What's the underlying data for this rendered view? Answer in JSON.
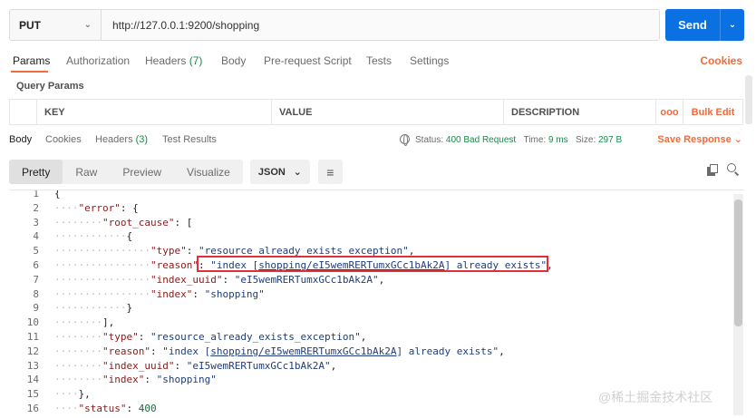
{
  "request": {
    "method": "PUT",
    "url": "http://127.0.0.1:9200/shopping",
    "send_label": "Send"
  },
  "request_tabs": [
    {
      "label": "Params",
      "active": true
    },
    {
      "label": "Authorization"
    },
    {
      "label": "Headers",
      "count": "(7)"
    },
    {
      "label": "Body"
    },
    {
      "label": "Pre-request Script"
    },
    {
      "label": "Tests"
    },
    {
      "label": "Settings"
    }
  ],
  "cookies_label": "Cookies",
  "query_params": {
    "title": "Query Params",
    "columns": [
      "KEY",
      "VALUE",
      "DESCRIPTION"
    ],
    "more_label": "ooo",
    "bulk_edit_label": "Bulk Edit"
  },
  "response_tabs": [
    {
      "label": "Body",
      "active": true
    },
    {
      "label": "Cookies"
    },
    {
      "label": "Headers",
      "count": "(3)"
    },
    {
      "label": "Test Results"
    }
  ],
  "response_status": {
    "status_label": "Status:",
    "status_value": "400 Bad Request",
    "time_label": "Time:",
    "time_value": "9 ms",
    "size_label": "Size:",
    "size_value": "297 B",
    "save_label": "Save Response"
  },
  "viewer": {
    "modes": [
      "Pretty",
      "Raw",
      "Preview",
      "Visualize"
    ],
    "active_mode": "Pretty",
    "format": "JSON"
  },
  "code_lines": [
    {
      "n": "1",
      "dots": "",
      "text": "{"
    },
    {
      "n": "2",
      "dots": "····",
      "text": "\"error\": {"
    },
    {
      "n": "3",
      "dots": "········",
      "text": "\"root_cause\": ["
    },
    {
      "n": "4",
      "dots": "············",
      "text": "{"
    },
    {
      "n": "5",
      "dots": "················",
      "text": "\"type\": \"resource_already_exists_exception\","
    },
    {
      "n": "6",
      "dots": "················",
      "text": "\"reason\": \"index [shopping/eI5wemRERTumxGCc1bAk2A] already exists\","
    },
    {
      "n": "7",
      "dots": "················",
      "text": "\"index_uuid\": \"eI5wemRERTumxGCc1bAk2A\","
    },
    {
      "n": "8",
      "dots": "················",
      "text": "\"index\": \"shopping\""
    },
    {
      "n": "9",
      "dots": "············",
      "text": "}"
    },
    {
      "n": "10",
      "dots": "········",
      "text": "],"
    },
    {
      "n": "11",
      "dots": "········",
      "text": "\"type\": \"resource_already_exists_exception\","
    },
    {
      "n": "12",
      "dots": "········",
      "text": "\"reason\": \"index [shopping/eI5wemRERTumxGCc1bAk2A] already exists\","
    },
    {
      "n": "13",
      "dots": "········",
      "text": "\"index_uuid\": \"eI5wemRERTumxGCc1bAk2A\","
    },
    {
      "n": "14",
      "dots": "········",
      "text": "\"index\": \"shopping\""
    },
    {
      "n": "15",
      "dots": "····",
      "text": "},"
    },
    {
      "n": "16",
      "dots": "····",
      "text": "\"status\": 400"
    }
  ],
  "watermark": "@稀土掘金技术社区",
  "colors": {
    "accent_orange": "#f26b3a",
    "send_blue": "#0b70e2",
    "status_green": "#1a8a4a",
    "highlight_red": "#e0303a"
  }
}
